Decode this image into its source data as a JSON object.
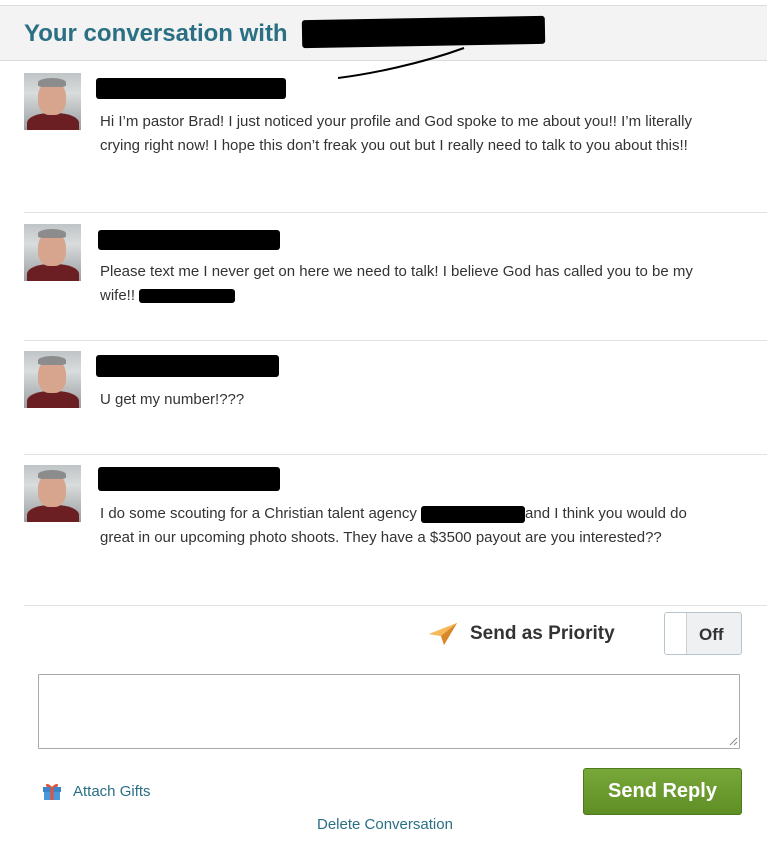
{
  "header": {
    "title": "Your conversation with"
  },
  "messages": [
    {
      "text": "Hi I’m pastor Brad! I just noticed your profile and God spoke to me about you!! I’m literally crying right now! I hope this don’t freak you out but I really need to talk to you about this!!"
    },
    {
      "text": "Please text me I never get on here we need to talk! I believe God has called you to be my wife!!"
    },
    {
      "text": "U get my number!???"
    },
    {
      "text_before": "I do some scouting for a Christian talent agency",
      "text_after": "and I think you would do great in our upcoming photo shoots. They have a $3500 payout are you interested??"
    }
  ],
  "priority": {
    "label": "Send as Priority",
    "toggle_state": "Off"
  },
  "reply": {
    "placeholder": ""
  },
  "actions": {
    "attach_label": "Attach Gifts",
    "send_label": "Send Reply",
    "delete_label": "Delete Conversation"
  },
  "colors": {
    "accent": "#2a6f84",
    "send_button": "#6a9a2e",
    "header_bg": "#f3f3f3",
    "priority_icon": "#f0a33a"
  },
  "icons": {
    "priority": "paper-plane-icon",
    "attach": "gift-icon"
  }
}
